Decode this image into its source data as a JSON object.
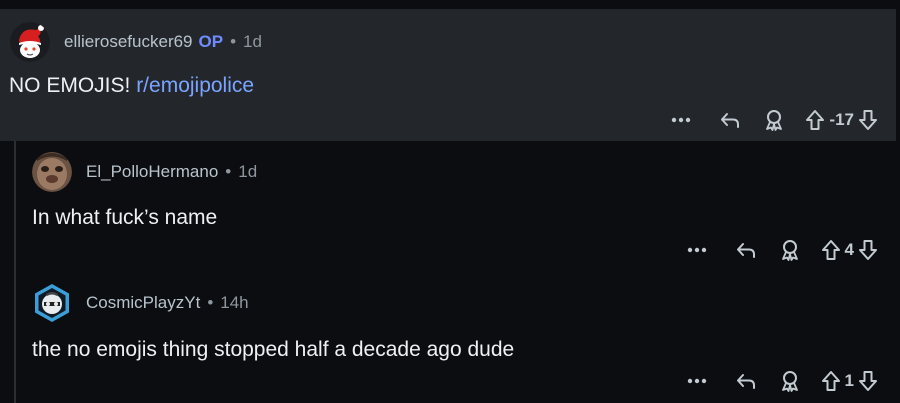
{
  "comments": [
    {
      "username": "ellierosefucker69",
      "op_badge": "OP",
      "separator": "•",
      "time": "1d",
      "body_prefix": "NO EMOJIS! ",
      "body_link": "r/emojipolice",
      "score": "-17"
    },
    {
      "username": "El_PolloHermano",
      "separator": "•",
      "time": "1d",
      "body": "In what fuck’s name",
      "score": "4"
    },
    {
      "username": "CosmicPlayzYt",
      "separator": "•",
      "time": "14h",
      "body": "the no emojis thing stopped half a decade ago dude",
      "score": "1"
    }
  ],
  "icons": {
    "more": "more-icon",
    "reply": "reply-icon",
    "award": "award-icon",
    "upvote": "upvote-icon",
    "downvote": "downvote-icon"
  },
  "colors": {
    "background": "#0b0d10",
    "op_highlight": "#23272b",
    "op_badge": "#6f8cff",
    "link": "#7aa4ff"
  }
}
